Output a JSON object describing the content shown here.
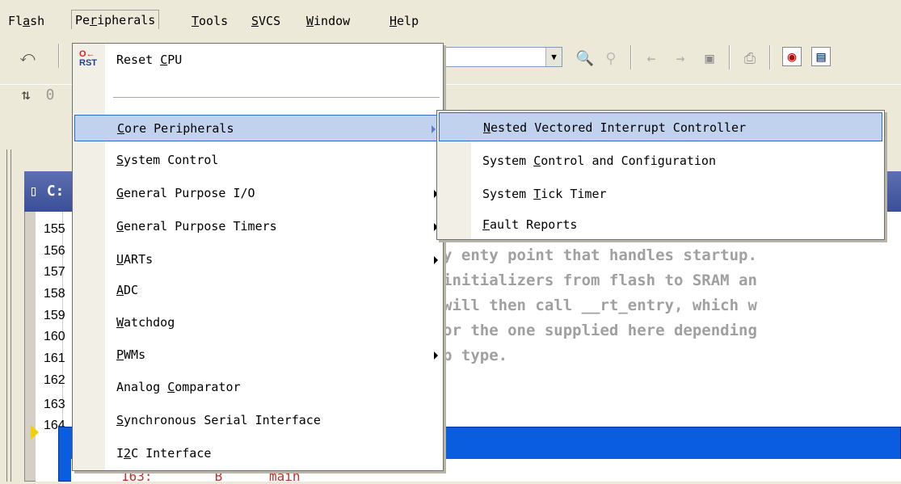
{
  "menubar": {
    "items": [
      {
        "pre": "Fl",
        "key": "a",
        "post": "sh"
      },
      {
        "pre": "Pe",
        "key": "r",
        "post": "ipherals"
      },
      {
        "pre": "",
        "key": "T",
        "post": "ools"
      },
      {
        "pre": "",
        "key": "S",
        "post": "VCS"
      },
      {
        "pre": "",
        "key": "W",
        "post": "indow"
      },
      {
        "pre": "",
        "key": "H",
        "post": "elp"
      }
    ]
  },
  "peripherals_menu": {
    "reset_icon": {
      "top": "O",
      "arrow": "←",
      "bottom": "RST"
    },
    "items": [
      {
        "pre": "Reset ",
        "key": "C",
        "post": "PU",
        "submenu": false
      },
      {
        "pre": "",
        "key": "C",
        "post": "ore Peripherals",
        "submenu": true
      },
      {
        "pre": "",
        "key": "S",
        "post": "ystem Control",
        "submenu": false
      },
      {
        "pre": "",
        "key": "G",
        "post": "eneral Purpose I/O",
        "submenu": true
      },
      {
        "pre": "",
        "key": "G",
        "post": "eneral Purpose Timers",
        "submenu": true
      },
      {
        "pre": "",
        "key": "U",
        "post": "ARTs",
        "submenu": true
      },
      {
        "pre": "",
        "key": "A",
        "post": "DC",
        "submenu": false
      },
      {
        "pre": "",
        "key": "W",
        "post": "atchdog",
        "submenu": false
      },
      {
        "pre": "",
        "key": "P",
        "post": "WMs",
        "submenu": true
      },
      {
        "pre": "Analog ",
        "key": "C",
        "post": "omparator",
        "submenu": false
      },
      {
        "pre": "",
        "key": "S",
        "post": "ynchronous Serial Interface",
        "submenu": false
      },
      {
        "pre": "I",
        "key": "2",
        "post": "C Interface",
        "submenu": false
      }
    ]
  },
  "core_peripherals_submenu": {
    "items": [
      {
        "pre": "",
        "key": "N",
        "post": "ested Vectored Interrupt Controller"
      },
      {
        "pre": "System ",
        "key": "C",
        "post": "ontrol and Configuration"
      },
      {
        "pre": "System ",
        "key": "T",
        "post": "ick Timer"
      },
      {
        "pre": "",
        "key": "F",
        "post": "ault Reports"
      }
    ]
  },
  "editor": {
    "title": "C:",
    "line_numbers": [
      "155",
      "156",
      "157",
      "158",
      "159",
      "160",
      "161",
      "162",
      "163",
      "164"
    ],
    "code_lines": [
      "y enty point that handles startup.",
      "initializers from flash to SRAM an",
      "will then call __rt_entry, which w",
      "or the one supplied here depending",
      "p type."
    ],
    "bottom_code": "163:        B      main"
  },
  "toolbar": {
    "icons": [
      "undo-icon",
      "find-icon",
      "find-in-files-icon",
      "back-icon",
      "forward-icon",
      "bookmark-icon",
      "print-icon",
      "debug-icon",
      "window-icon",
      "rebuild-icon"
    ]
  }
}
